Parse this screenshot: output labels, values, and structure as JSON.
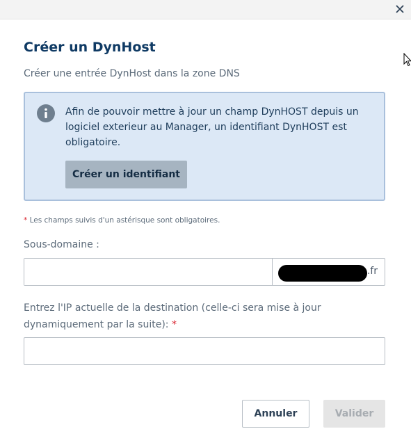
{
  "dialog": {
    "title": "Créer un DynHost",
    "subtitle": "Créer une entrée DynHost dans la zone DNS",
    "close_icon": "close-icon"
  },
  "info": {
    "icon": "info-icon",
    "text": "Afin de pouvoir mettre à jour un champ DynHOST depuis un logiciel exterieur au Manager, un identifiant DynHOST est obligatoire.",
    "button_label": "Créer un identifiant"
  },
  "form": {
    "required_star": "*",
    "required_note": "Les champs suivis d'un astérisque sont obligatoires.",
    "subdomain": {
      "label": "Sous-domaine :",
      "value": "",
      "suffix": ".fr"
    },
    "ip": {
      "label": "Entrez l'IP actuelle de la destination (celle-ci sera mise à jour dynamiquement par la suite):",
      "required_star": "*",
      "value": ""
    }
  },
  "actions": {
    "cancel_label": "Annuler",
    "validate_label": "Valider"
  },
  "colors": {
    "title": "#0f3a64",
    "info_bg": "#dce8f6",
    "info_border": "#a9c0dc",
    "required": "#d9232e",
    "secondary_button": "#a6b4c1",
    "disabled_button": "#e5e5e5"
  }
}
